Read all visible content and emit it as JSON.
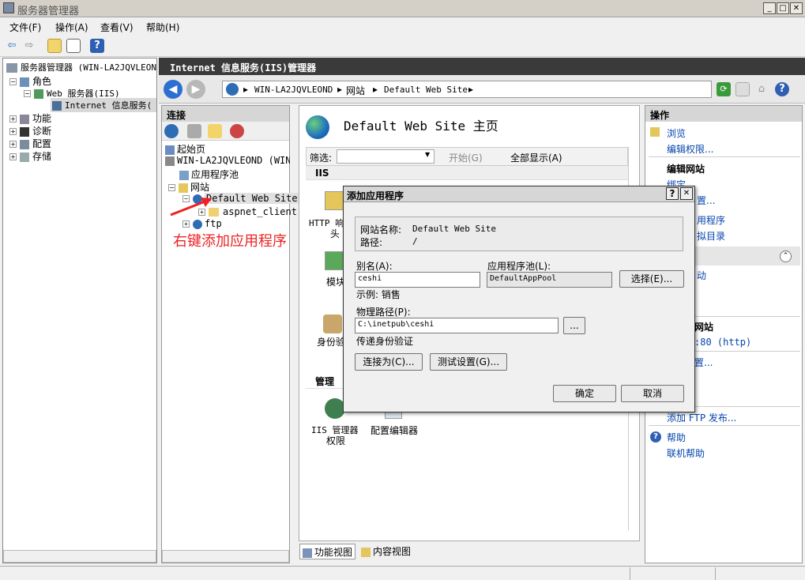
{
  "window": {
    "title": "服务器管理器"
  },
  "menu": [
    "文件(F)",
    "操作(A)",
    "查看(V)",
    "帮助(H)"
  ],
  "tree": {
    "root": "服务器管理器 (WIN-LA2JQVLEON",
    "roles": "角色",
    "web": "Web 服务器(IIS)",
    "iis": "Internet 信息服务(",
    "features": "功能",
    "diagnostics": "诊断",
    "config": "配置",
    "storage": "存储"
  },
  "iis": {
    "header": "Internet 信息服务(IIS)管理器",
    "breadcrumb": [
      "WIN-LA2JQVLEOND",
      "网站",
      "Default Web Site"
    ]
  },
  "connections": {
    "title": "连接",
    "start": "起始页",
    "server": "WIN-LA2JQVLEOND (WIN-LA",
    "apppools": "应用程序池",
    "sites": "网站",
    "default_site": "Default Web Site",
    "aspnet": "aspnet_client",
    "ftp": "ftp"
  },
  "annotation": "右键添加应用程序",
  "center": {
    "title": "Default Web Site 主页",
    "filter_label": "筛选:",
    "start_btn": "开始(G)",
    "showall": "全部显示(A)",
    "group_iis": "IIS",
    "http": "HTTP 响",
    "http2": "头",
    "module": "模块",
    "auth": "身份验",
    "group_mgmt": "管理",
    "iis_mgr": "IIS 管理器",
    "iis_mgr2": "权限",
    "cfg_editor": "配置编辑器",
    "tab_feature": "功能视图",
    "tab_content": "内容视图"
  },
  "actions": {
    "title": "操作",
    "browse": "浏览",
    "edit_perm": "编辑权限...",
    "edit_site": "编辑网站",
    "bind": "绑定",
    "settings": "置...",
    "apps": "用程序",
    "vdirs": "拟目录",
    "start": "动",
    "site": "网站",
    "port": ":80 (http)",
    "settings2": "置...",
    "ftp": "添加 FTP 发布...",
    "help": "帮助",
    "online_help": "联机帮助"
  },
  "dialog": {
    "title": "添加应用程序",
    "site_label": "网站名称:",
    "site_value": "Default Web Site",
    "path_label": "路径:",
    "path_value": "/",
    "alias_label": "别名(A):",
    "alias_value": "ceshi",
    "pool_label": "应用程序池(L):",
    "pool_value": "DefaultAppPool",
    "select_btn": "选择(E)...",
    "example": "示例: 销售",
    "phys_label": "物理路径(P):",
    "phys_value": "C:\\inetpub\\ceshi",
    "browse_btn": "...",
    "passthru": "传递身份验证",
    "connect_btn": "连接为(C)...",
    "test_btn": "测试设置(G)...",
    "ok_btn": "确定",
    "cancel_btn": "取消",
    "help_btn": "?",
    "close_btn": "✕"
  }
}
